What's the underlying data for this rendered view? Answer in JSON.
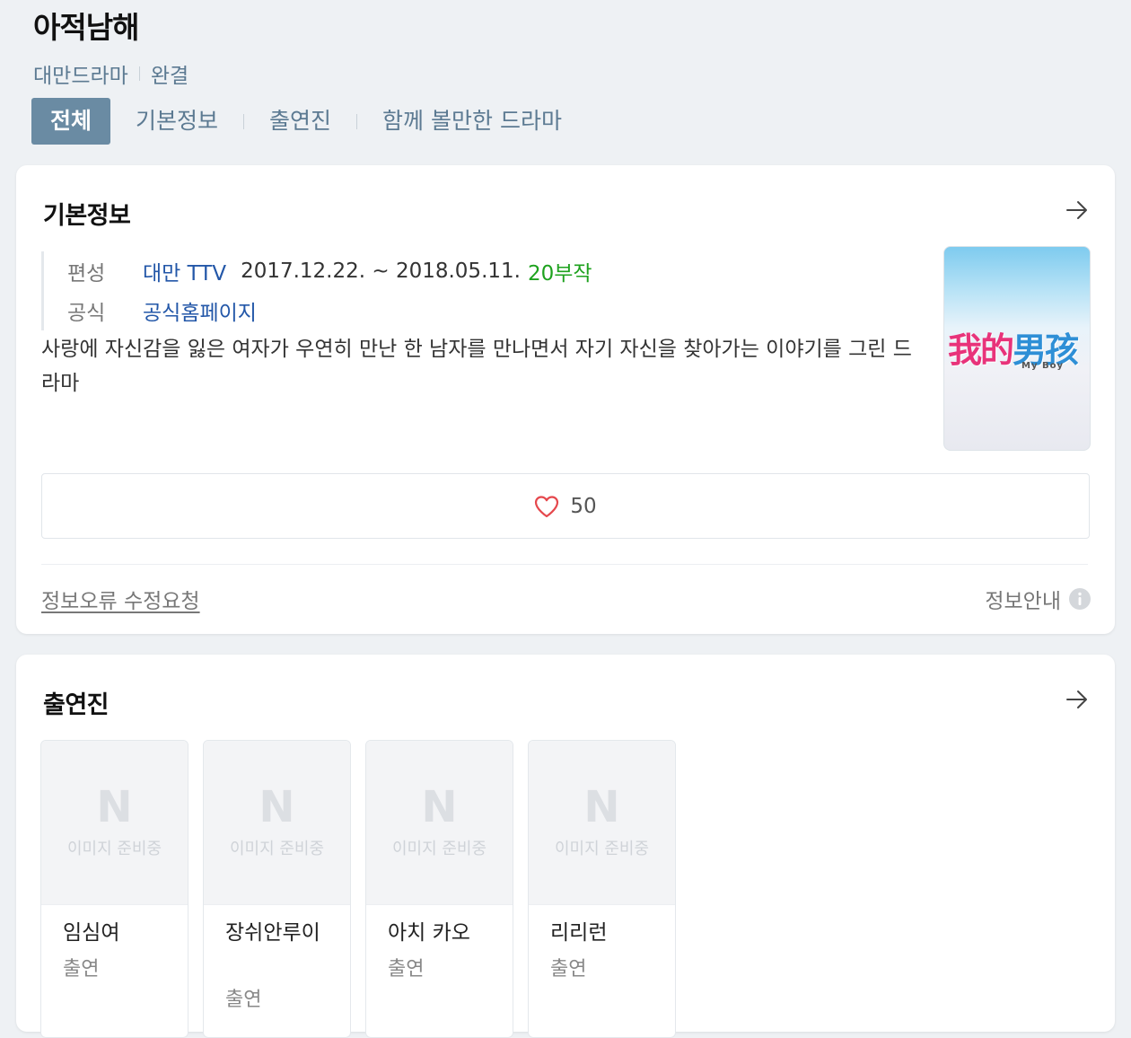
{
  "header": {
    "title": "아적남해",
    "genre": "대만드라마",
    "status": "완결"
  },
  "tabs": [
    {
      "label": "전체",
      "active": true
    },
    {
      "label": "기본정보",
      "active": false
    },
    {
      "label": "출연진",
      "active": false
    },
    {
      "label": "함께 볼만한 드라마",
      "active": false
    }
  ],
  "info": {
    "section_title": "기본정보",
    "broadcast_label": "편성",
    "broadcaster": "대만 TTV",
    "period": "2017.12.22. ~ 2018.05.11.",
    "episodes": "20부작",
    "official_label": "공식",
    "official_link": "공식홈페이지",
    "synopsis": "사랑에 자신감을 잃은 여자가 우연히 만난 한 남자를 만나면서 자기 자신을 찾아가는 이야기를 그린 드라마",
    "poster_title_pink": "我的",
    "poster_title_blue": "男孩",
    "poster_subtitle": "My Boy",
    "like_count": "50",
    "report_link": "정보오류 수정요청",
    "info_guide": "정보안내"
  },
  "cast": {
    "section_title": "출연진",
    "placeholder_logo": "N",
    "placeholder_text": "이미지 준비중",
    "members": [
      {
        "name": "임심여",
        "role": "출연"
      },
      {
        "name": "장쉬안루이",
        "role": "출연"
      },
      {
        "name": "아치 카오",
        "role": "출연"
      },
      {
        "name": "리리런",
        "role": "출연"
      }
    ]
  },
  "colors": {
    "accent_tab": "#6a8ba3",
    "link_blue": "#2357a8",
    "episodes_green": "#1ea21e",
    "heart_red": "#e5484d",
    "page_bg": "#eef1f4"
  }
}
